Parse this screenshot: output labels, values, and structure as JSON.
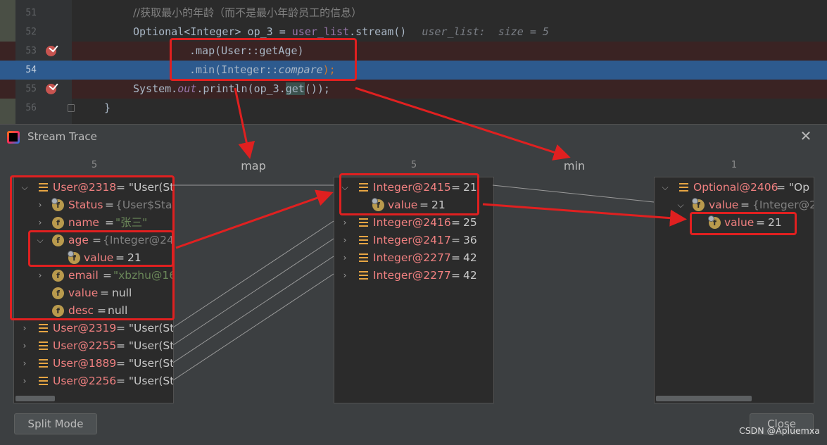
{
  "editor": {
    "lines": [
      {
        "number": "51",
        "code": "//获取最小的年龄（而不是最小年龄员工的信息）"
      },
      {
        "number": "52",
        "code_parts": [
          "Optional<Integer> op_3 = ",
          "user_list",
          ".stream()"
        ],
        "hint": "user_list:  size = 5"
      },
      {
        "number": "53",
        "code_parts": [
          ".map(User::getAge)"
        ],
        "breakpoint": true
      },
      {
        "number": "54",
        "code_parts": [
          ".min(Integer::",
          "compare",
          ");"
        ],
        "selected": true
      },
      {
        "number": "55",
        "code_parts": [
          "System.",
          "out",
          ".println(op_3.",
          "get",
          "());"
        ],
        "breakpoint": true
      },
      {
        "number": "56",
        "code_parts": [
          "}"
        ]
      }
    ]
  },
  "dialog": {
    "title": "Stream Trace",
    "close_icon": "close-icon",
    "columns": [
      {
        "count": "5"
      },
      {
        "operation": "map"
      },
      {
        "count": "5"
      },
      {
        "operation": "min"
      },
      {
        "count": "1"
      }
    ],
    "left_panel": {
      "rows": [
        {
          "name": "User@2318",
          "value": " = \"User(St"
        },
        {
          "name": "Status",
          "value": "{User$Statu"
        },
        {
          "name": "name",
          "value": "\"张三\""
        },
        {
          "name": "age",
          "value": "{Integer@24"
        },
        {
          "name": "value",
          "value": "21"
        },
        {
          "name": "email",
          "value": "\"xbzhu@16"
        },
        {
          "name": "value",
          "value": "null"
        },
        {
          "name": "desc",
          "value": "null"
        },
        {
          "name": "User@2319",
          "value": " = \"User(St"
        },
        {
          "name": "User@2255",
          "value": " = \"User(St"
        },
        {
          "name": "User@1889",
          "value": " = \"User(St"
        },
        {
          "name": "User@2256",
          "value": " = \"User(St"
        }
      ]
    },
    "middle_panel": {
      "rows": [
        {
          "name": "Integer@2415",
          "value": "21"
        },
        {
          "name": "value",
          "value": "21"
        },
        {
          "name": "Integer@2416",
          "value": "25"
        },
        {
          "name": "Integer@2417",
          "value": "36"
        },
        {
          "name": "Integer@2277",
          "value": "42"
        },
        {
          "name": "Integer@2277",
          "value": "42"
        }
      ]
    },
    "right_panel": {
      "rows": [
        {
          "name": "Optional@2406",
          "value": " = \"Op"
        },
        {
          "name": "value",
          "value": "{Integer@2"
        },
        {
          "name": "value",
          "value": "21"
        }
      ]
    },
    "buttons": {
      "split_mode": "Split Mode",
      "close": "Close"
    }
  },
  "watermark": "CSDN @Apluemxa",
  "colors": {
    "annotation": "#e02020",
    "selection": "#2d5a8e",
    "breakpoint_line": "#3a2323"
  }
}
